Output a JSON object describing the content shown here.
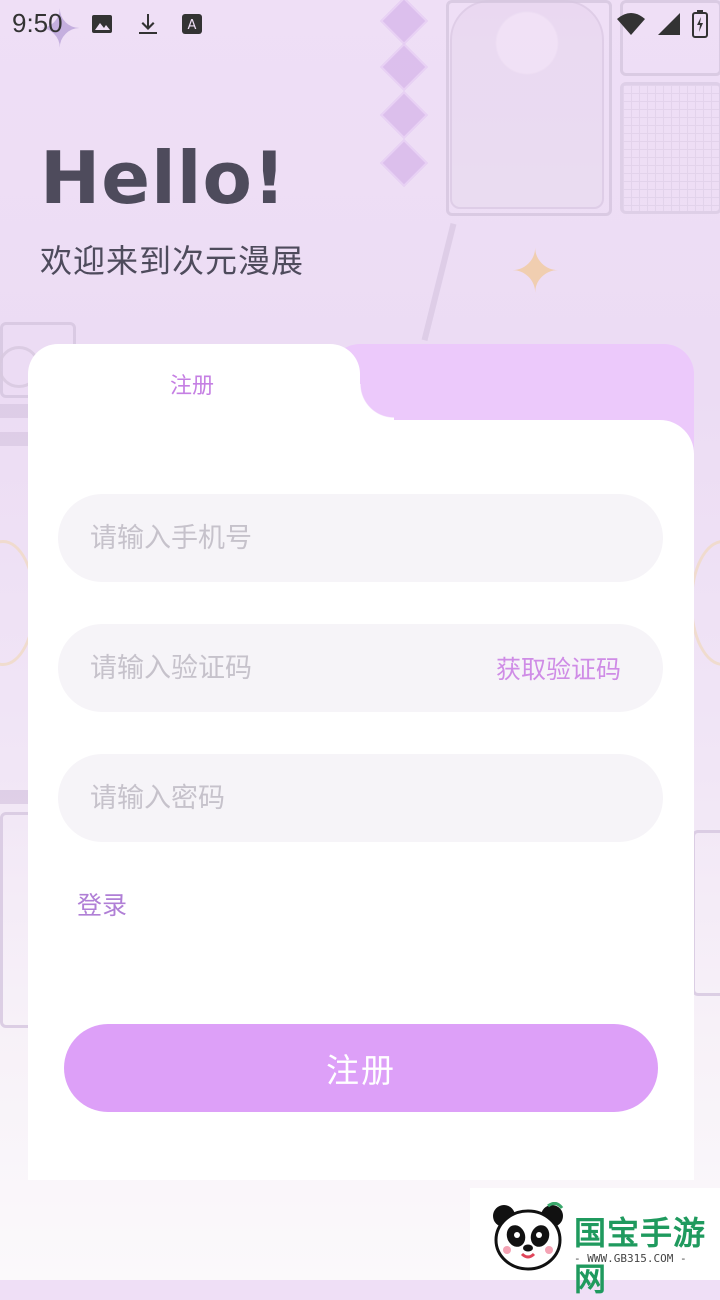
{
  "status_bar": {
    "time": "9:50",
    "icons_left": [
      "image-icon",
      "download-icon",
      "text-a-icon"
    ],
    "icons_right": [
      "wifi-icon",
      "signal-icon",
      "battery-icon"
    ]
  },
  "header": {
    "greeting": "Hello!",
    "subtitle": "欢迎来到次元漫展"
  },
  "tabs": [
    {
      "label": "注册",
      "active": true
    }
  ],
  "form": {
    "phone_placeholder": "请输入手机号",
    "code_placeholder": "请输入验证码",
    "get_code_label": "获取验证码",
    "password_placeholder": "请输入密码",
    "login_link": "登录",
    "submit_label": "注册"
  },
  "watermark": {
    "title": "国宝手游网",
    "url": "- WWW.GB315.COM -"
  },
  "colors": {
    "accent": "#dda0f8",
    "tab_back": "#ecc9fb",
    "link": "#b07fd6",
    "heading": "#4e4b5c",
    "field_bg": "#f6f4f8"
  }
}
